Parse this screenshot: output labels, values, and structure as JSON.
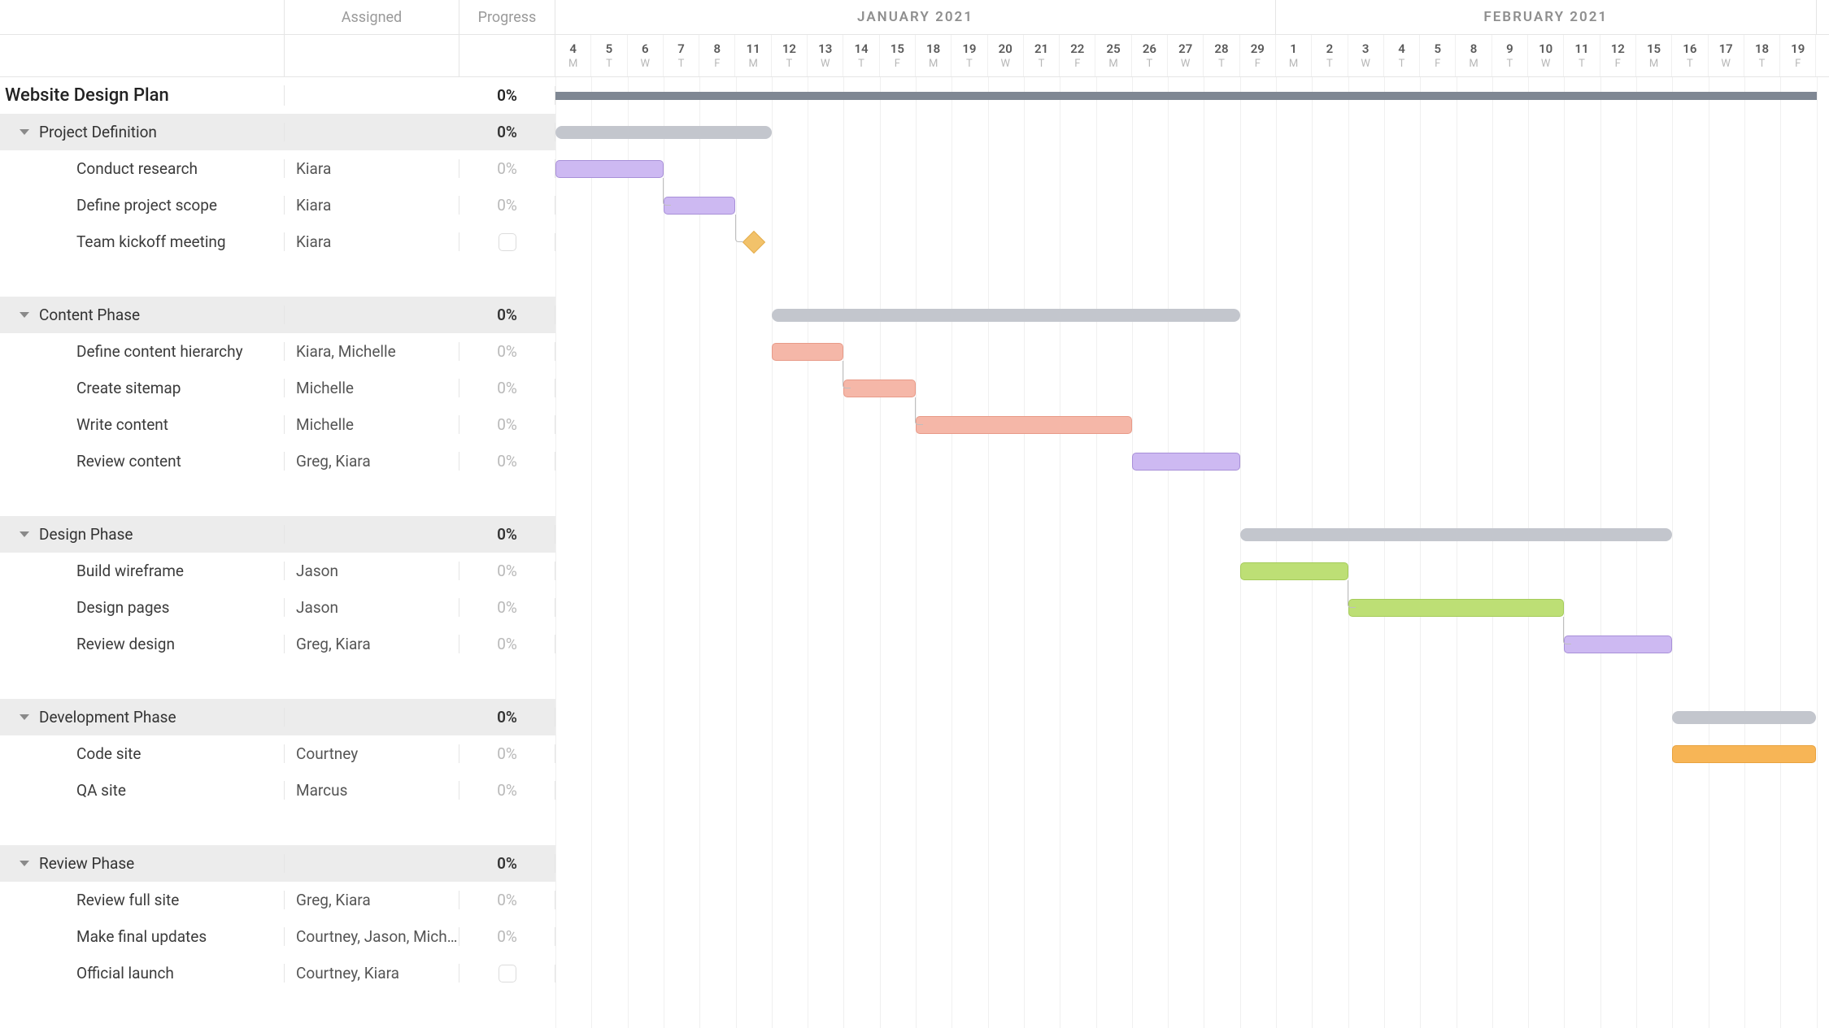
{
  "columns": {
    "assigned_label": "Assigned",
    "progress_label": "Progress"
  },
  "months": [
    {
      "label": "JANUARY 2021",
      "span_days": 20
    },
    {
      "label": "FEBRUARY 2021",
      "span_days": 15
    }
  ],
  "days": [
    {
      "n": "4",
      "d": "M"
    },
    {
      "n": "5",
      "d": "T"
    },
    {
      "n": "6",
      "d": "W"
    },
    {
      "n": "7",
      "d": "T"
    },
    {
      "n": "8",
      "d": "F"
    },
    {
      "n": "11",
      "d": "M"
    },
    {
      "n": "12",
      "d": "T"
    },
    {
      "n": "13",
      "d": "W"
    },
    {
      "n": "14",
      "d": "T"
    },
    {
      "n": "15",
      "d": "F"
    },
    {
      "n": "18",
      "d": "M"
    },
    {
      "n": "19",
      "d": "T"
    },
    {
      "n": "20",
      "d": "W"
    },
    {
      "n": "21",
      "d": "T"
    },
    {
      "n": "22",
      "d": "F"
    },
    {
      "n": "25",
      "d": "M"
    },
    {
      "n": "26",
      "d": "T"
    },
    {
      "n": "27",
      "d": "W"
    },
    {
      "n": "28",
      "d": "T"
    },
    {
      "n": "29",
      "d": "F"
    },
    {
      "n": "1",
      "d": "M"
    },
    {
      "n": "2",
      "d": "T"
    },
    {
      "n": "3",
      "d": "W"
    },
    {
      "n": "4",
      "d": "T"
    },
    {
      "n": "5",
      "d": "F"
    },
    {
      "n": "8",
      "d": "M"
    },
    {
      "n": "9",
      "d": "T"
    },
    {
      "n": "10",
      "d": "W"
    },
    {
      "n": "11",
      "d": "T"
    },
    {
      "n": "12",
      "d": "F"
    },
    {
      "n": "15",
      "d": "M"
    },
    {
      "n": "16",
      "d": "T"
    },
    {
      "n": "17",
      "d": "W"
    },
    {
      "n": "18",
      "d": "T"
    },
    {
      "n": "19",
      "d": "F"
    }
  ],
  "project": {
    "title": "Website Design Plan",
    "progress": "0%"
  },
  "sections": [
    {
      "title": "Project Definition",
      "progress": "0%",
      "tasks": [
        {
          "title": "Conduct research",
          "assigned": "Kiara",
          "progress": "0%"
        },
        {
          "title": "Define project scope",
          "assigned": "Kiara",
          "progress": "0%"
        },
        {
          "title": "Team kickoff meeting",
          "assigned": "Kiara",
          "progress": "",
          "milestone": true
        }
      ]
    },
    {
      "title": "Content Phase",
      "progress": "0%",
      "tasks": [
        {
          "title": "Define content hierarchy",
          "assigned": "Kiara, Michelle",
          "progress": "0%"
        },
        {
          "title": "Create sitemap",
          "assigned": "Michelle",
          "progress": "0%"
        },
        {
          "title": "Write content",
          "assigned": "Michelle",
          "progress": "0%"
        },
        {
          "title": "Review content",
          "assigned": "Greg, Kiara",
          "progress": "0%"
        }
      ]
    },
    {
      "title": "Design Phase",
      "progress": "0%",
      "tasks": [
        {
          "title": "Build wireframe",
          "assigned": "Jason",
          "progress": "0%"
        },
        {
          "title": "Design pages",
          "assigned": "Jason",
          "progress": "0%"
        },
        {
          "title": "Review design",
          "assigned": "Greg, Kiara",
          "progress": "0%"
        }
      ]
    },
    {
      "title": "Development Phase",
      "progress": "0%",
      "tasks": [
        {
          "title": "Code site",
          "assigned": "Courtney",
          "progress": "0%"
        },
        {
          "title": "QA site",
          "assigned": "Marcus",
          "progress": "0%"
        }
      ]
    },
    {
      "title": "Review Phase",
      "progress": "0%",
      "tasks": [
        {
          "title": "Review full site",
          "assigned": "Greg, Kiara",
          "progress": "0%"
        },
        {
          "title": "Make final updates",
          "assigned": "Courtney, Jason, Michelle",
          "progress": "0%"
        },
        {
          "title": "Official launch",
          "assigned": "Courtney, Kiara",
          "progress": "",
          "milestone": true
        }
      ]
    }
  ],
  "chart_data": {
    "type": "gantt",
    "unit": "business-day-index",
    "x_axis": "days array index (0 = Jan 4 2021)",
    "bars": [
      {
        "row": "project",
        "kind": "grey",
        "start": 0,
        "end": 35
      },
      {
        "row": "Project Definition",
        "kind": "summary",
        "start": 0,
        "end": 6
      },
      {
        "row": "Conduct research",
        "kind": "purple",
        "start": 0,
        "end": 3
      },
      {
        "row": "Define project scope",
        "kind": "purple",
        "start": 3,
        "end": 5
      },
      {
        "row": "Team kickoff meeting",
        "kind": "milestone",
        "at": 5
      },
      {
        "row": "Content Phase",
        "kind": "summary",
        "start": 6,
        "end": 19
      },
      {
        "row": "Define content hierarchy",
        "kind": "salmon",
        "start": 6,
        "end": 8
      },
      {
        "row": "Create sitemap",
        "kind": "salmon",
        "start": 8,
        "end": 10
      },
      {
        "row": "Write content",
        "kind": "salmon",
        "start": 10,
        "end": 16
      },
      {
        "row": "Review content",
        "kind": "purple",
        "start": 16,
        "end": 19
      },
      {
        "row": "Design Phase",
        "kind": "summary",
        "start": 19,
        "end": 31
      },
      {
        "row": "Build wireframe",
        "kind": "green",
        "start": 19,
        "end": 22
      },
      {
        "row": "Design pages",
        "kind": "green",
        "start": 22,
        "end": 28
      },
      {
        "row": "Review design",
        "kind": "purple",
        "start": 28,
        "end": 31
      },
      {
        "row": "Development Phase",
        "kind": "summary",
        "start": 31,
        "end": 35
      },
      {
        "row": "Code site",
        "kind": "orange",
        "start": 31,
        "end": 35
      }
    ]
  }
}
